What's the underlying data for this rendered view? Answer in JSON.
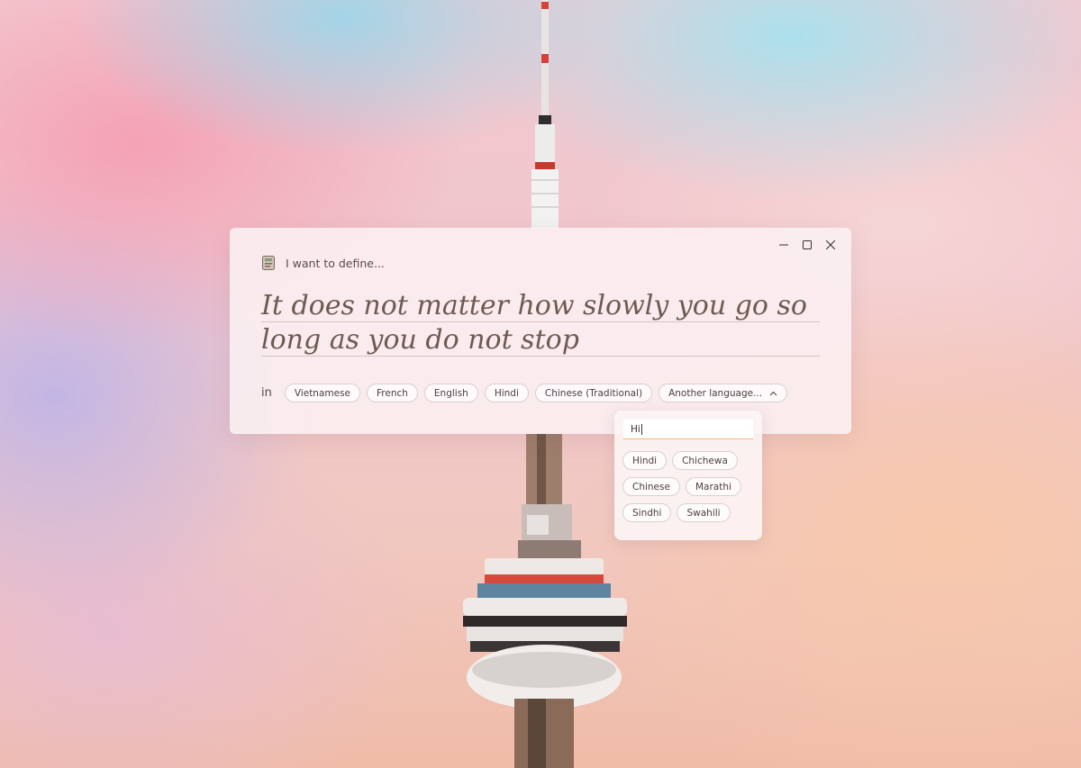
{
  "window": {
    "controls": {
      "minimize": "minimize-icon",
      "maximize": "maximize-icon",
      "close": "close-icon"
    },
    "define_label": "I want to define...",
    "phrase": "It does not matter how slowly you go so long as you do not stop",
    "in_label": "in",
    "languages": [
      {
        "label": "Vietnamese"
      },
      {
        "label": "French"
      },
      {
        "label": "English"
      },
      {
        "label": "Hindi"
      },
      {
        "label": "Chinese (Traditional)"
      }
    ],
    "another_language": {
      "label": "Another language...",
      "icon": "chevron-up-icon"
    }
  },
  "dropdown": {
    "search_value": "Hi",
    "results": [
      {
        "label": "Hindi"
      },
      {
        "label": "Chichewa"
      },
      {
        "label": "Chinese"
      },
      {
        "label": "Marathi"
      },
      {
        "label": "Sindhi"
      },
      {
        "label": "Swahili"
      }
    ]
  },
  "colors": {
    "accent_underline": "#e9b97a",
    "phrase_text": "#6e5a52",
    "panel": "#faf0f2"
  }
}
